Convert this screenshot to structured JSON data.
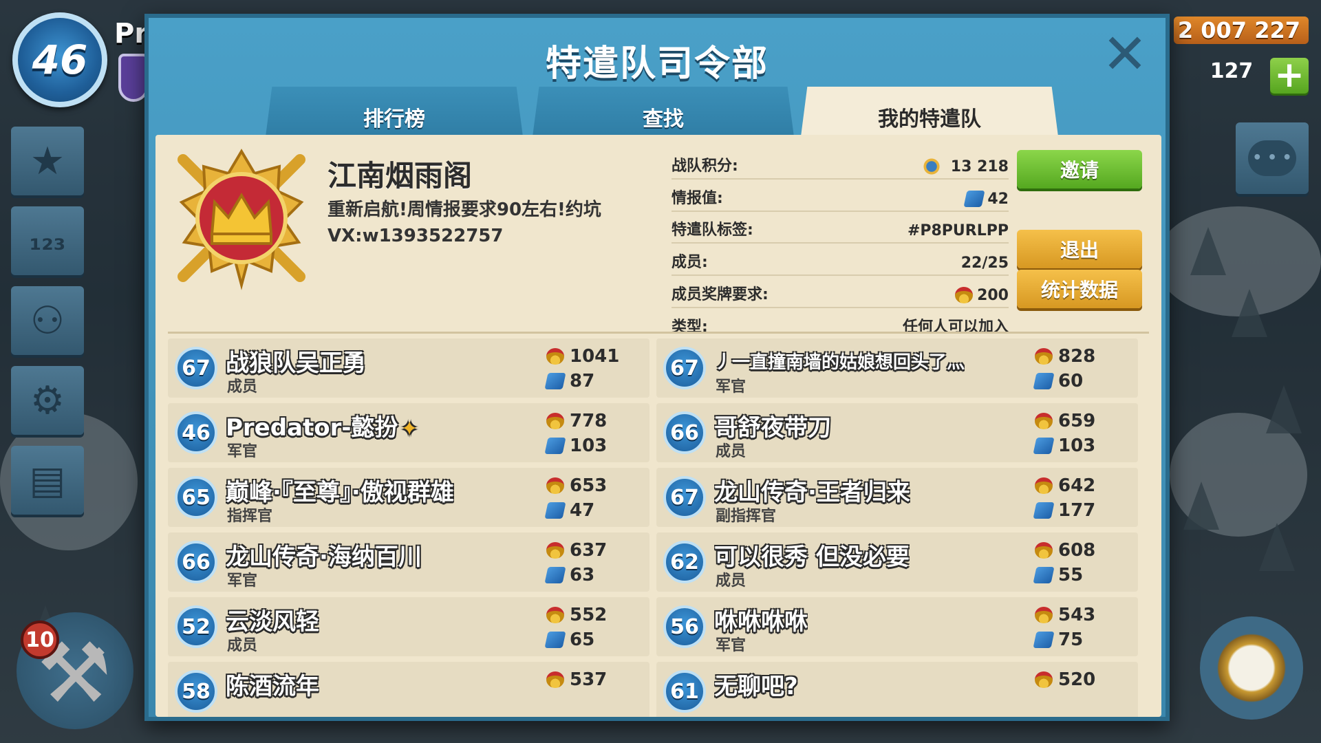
{
  "hud": {
    "player_level": "46",
    "player_name": "Pr",
    "gold": "2 007 227",
    "gems": "127",
    "plus_label": "+",
    "builder_count": "10"
  },
  "modal": {
    "title": "特遣队司令部",
    "tabs": [
      {
        "label": "排行榜",
        "active": false
      },
      {
        "label": "查找",
        "active": false
      },
      {
        "label": "我的特遣队",
        "active": true
      }
    ]
  },
  "clan": {
    "name": "江南烟雨阁",
    "description_line1": "重新启航!周情报要求90左右!约坑",
    "description_line2": "VX:w1393522757",
    "info": [
      {
        "label": "战队积分:",
        "value": "13 218",
        "icon": "victory-points-icon"
      },
      {
        "label": "情报值:",
        "value": "42",
        "icon": "intel-icon"
      },
      {
        "label": "特遣队标签:",
        "value": "#P8PURLPP",
        "icon": ""
      },
      {
        "label": "成员:",
        "value": "22/25",
        "icon": ""
      },
      {
        "label": "成员奖牌要求:",
        "value": "200",
        "icon": "medal-icon"
      },
      {
        "label": "类型:",
        "value": "任何人可以加入",
        "icon": ""
      }
    ],
    "buttons": {
      "invite": "邀请",
      "leave": "退出",
      "stats": "统计数据"
    }
  },
  "members": [
    {
      "level": "67",
      "name": "战狼队吴正勇",
      "role": "成员",
      "medals": "1041",
      "intel": "87"
    },
    {
      "level": "67",
      "name": "丿一直撞南墙的姑娘想回头了灬",
      "role": "军官",
      "medals": "828",
      "intel": "60"
    },
    {
      "level": "46",
      "name": "Predator-懿扮",
      "role": "军官",
      "medals": "778",
      "intel": "103"
    },
    {
      "level": "66",
      "name": "哥舒夜带刀",
      "role": "成员",
      "medals": "659",
      "intel": "103"
    },
    {
      "level": "65",
      "name": "巅峰·『至尊』·傲视群雄",
      "role": "指挥官",
      "medals": "653",
      "intel": "47"
    },
    {
      "level": "67",
      "name": "龙山传奇·王者归来",
      "role": "副指挥官",
      "medals": "642",
      "intel": "177"
    },
    {
      "level": "66",
      "name": "龙山传奇·海纳百川",
      "role": "军官",
      "medals": "637",
      "intel": "63"
    },
    {
      "level": "62",
      "name": "可以很秀 但没必要",
      "role": "成员",
      "medals": "608",
      "intel": "55"
    },
    {
      "level": "52",
      "name": "云淡风轻",
      "role": "成员",
      "medals": "552",
      "intel": "65"
    },
    {
      "level": "56",
      "name": "咻咻咻咻",
      "role": "军官",
      "medals": "543",
      "intel": "75"
    },
    {
      "level": "58",
      "name": "陈酒流年",
      "role": "",
      "medals": "537",
      "intel": ""
    },
    {
      "level": "61",
      "name": "无聊吧?",
      "role": "",
      "medals": "520",
      "intel": ""
    }
  ]
}
